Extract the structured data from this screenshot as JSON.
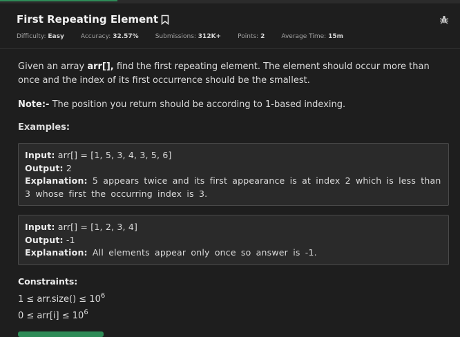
{
  "problem": {
    "title": "First Repeating Element",
    "meta": [
      {
        "label": "Difficulty:",
        "value": "Easy"
      },
      {
        "label": "Accuracy:",
        "value": "32.57%"
      },
      {
        "label": "Submissions:",
        "value": "312K+"
      },
      {
        "label": "Points:",
        "value": "2"
      },
      {
        "label": "Average Time:",
        "value": "15m"
      }
    ]
  },
  "description": {
    "p1_a": "Given an array ",
    "p1_b": "arr[],",
    "p1_c": " find the first repeating element. The element should occur more than once and the index of its first occurrence should be the smallest.",
    "note_label": "Note:-",
    "note_text": " The position you return should be according to 1-based indexing.",
    "examples_heading": "Examples:"
  },
  "examples": [
    {
      "input_label": "Input:",
      "input": " arr[] = [1, 5, 3, 4, 3, 5, 6]",
      "output_label": "Output:",
      "output": " 2",
      "explanation_label": "Explanation:",
      "explanation": " 5 appears twice and its first appearance is at index 2 which is less than 3 whose first the occurring index is 3."
    },
    {
      "input_label": "Input:",
      "input": " arr[] = [1, 2, 3, 4]",
      "output_label": "Output:",
      "output": " -1",
      "explanation_label": "Explanation:",
      "explanation": " All elements appear only once so answer is -1."
    }
  ],
  "constraints": {
    "heading": "Constraints:",
    "c1_text": "1 ≤ arr.size() ≤ 10",
    "c1_exp": "6",
    "c2_text": "0 ≤ arr[i] ≤ 10",
    "c2_exp": "6"
  },
  "icons": {
    "bookmark": "bookmark-icon",
    "bug": "bug-icon"
  },
  "colors": {
    "background": "#1e1e1e",
    "card": "#2a2a2a",
    "accent": "#2e8b57"
  }
}
